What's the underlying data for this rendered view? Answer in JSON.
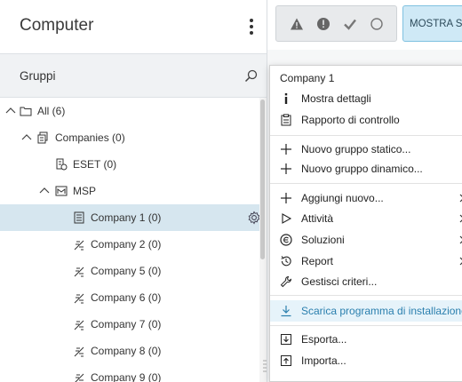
{
  "header": {
    "title": "Computer"
  },
  "groups_bar": {
    "label": "Gruppi"
  },
  "tree": [
    {
      "label": "All (6)",
      "icon": "folder-icon",
      "level": 0,
      "expanded": true
    },
    {
      "label": "Companies (0)",
      "icon": "companies-icon",
      "level": 1,
      "expanded": true
    },
    {
      "label": "ESET (0)",
      "icon": "company-icon",
      "level": 2
    },
    {
      "label": "MSP",
      "icon": "msp-icon",
      "level": 2,
      "expanded": true
    },
    {
      "label": "Company 1 (0)",
      "icon": "building-icon",
      "level": 3,
      "selected": true
    },
    {
      "label": "Company 2 (0)",
      "icon": "company-icon",
      "level": 3
    },
    {
      "label": "Company 5 (0)",
      "icon": "company-icon",
      "level": 3
    },
    {
      "label": "Company 6 (0)",
      "icon": "company-icon",
      "level": 3
    },
    {
      "label": "Company 7 (0)",
      "icon": "company-icon",
      "level": 3
    },
    {
      "label": "Company 8 (0)",
      "icon": "company-icon",
      "level": 3
    },
    {
      "label": "Company 9 (0)",
      "icon": "company-icon",
      "level": 3
    }
  ],
  "toolbar": {
    "status_icons": [
      "warning-icon",
      "error-icon",
      "check-icon",
      "circle-icon"
    ],
    "mostra_label": "MOSTRA SO"
  },
  "context_menu": {
    "header": "Company 1",
    "items": [
      {
        "label": "Mostra dettagli",
        "icon": "info-icon"
      },
      {
        "label": "Rapporto di controllo",
        "icon": "clipboard-icon"
      },
      {
        "label": "Nuovo gruppo statico...",
        "icon": "plus-icon"
      },
      {
        "label": "Nuovo gruppo dinamico...",
        "icon": "plus-icon"
      },
      {
        "label": "Aggiungi nuovo...",
        "icon": "plus-icon",
        "submenu": true
      },
      {
        "label": "Attività",
        "icon": "play-icon",
        "submenu": true
      },
      {
        "label": "Soluzioni",
        "icon": "solutions-icon",
        "submenu": true
      },
      {
        "label": "Report",
        "icon": "history-icon",
        "submenu": true
      },
      {
        "label": "Gestisci criteri...",
        "icon": "wrench-icon"
      },
      {
        "label": "Scarica programma di installazione",
        "icon": "download-icon",
        "highlight": true
      },
      {
        "label": "Esporta...",
        "icon": "export-icon"
      },
      {
        "label": "Importa...",
        "icon": "import-icon"
      }
    ]
  },
  "colors": {
    "selected_row": "#d6e6ef",
    "accent": "#2a7fae",
    "mostra_bg": "#cfe9f6"
  }
}
